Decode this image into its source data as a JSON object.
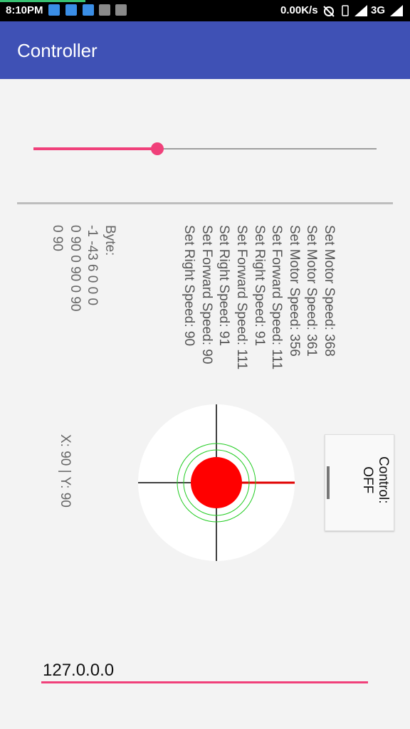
{
  "status_bar": {
    "time": "8:10PM",
    "net_speed": "0.00K/s",
    "network_type": "3G",
    "icons": [
      "mail-check-icon",
      "cloud-icon",
      "mail-check-icon",
      "play-store-icon",
      "play-store-icon",
      "alarm-off-icon",
      "vibrate-icon",
      "signal-icon",
      "signal-icon"
    ]
  },
  "app_bar": {
    "title": "Controller",
    "color": "#3f51b5"
  },
  "speed_slider": {
    "value_fraction": 0.36,
    "accent": "#f0407a"
  },
  "log_text": "Set Motor Speed: 368\nSet Motor Speed: 361\nSet Motor Speed: 356\nSet Forward Speed: 111\nSet Right Speed: 91\nSet Forward Speed: 111\nSet Right Speed: 91\nSet Forward Speed: 90\nSet Right Speed: 90",
  "byte_text": "Byte:\n-1 -43 6 0 0 0\n0 90 0 90 0 90\n0 90",
  "xy_text": "X: 90 | Y: 90",
  "control_button": {
    "label": "Control:\nOFF"
  },
  "joystick": {
    "knob_color": "#ff0000",
    "ring_color": "#22cc22",
    "pointer_color": "#ee0000",
    "crosshair_color": "#000000"
  },
  "ip_input": {
    "value": "127.0.0.0",
    "underline_color": "#f0407a"
  }
}
